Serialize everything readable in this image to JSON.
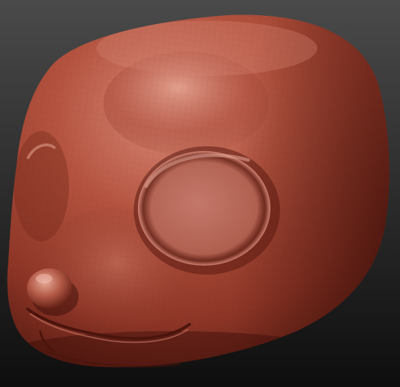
{
  "scene": {
    "subject": "sculpted-head",
    "colors": {
      "background_top": "#4a4a4a",
      "background_bottom": "#0e0e0e",
      "clay_base": "#9a3d2e",
      "clay_highlight": "#d98a78",
      "clay_shadow": "#4a140c",
      "eye_socket": "#b86455"
    }
  }
}
